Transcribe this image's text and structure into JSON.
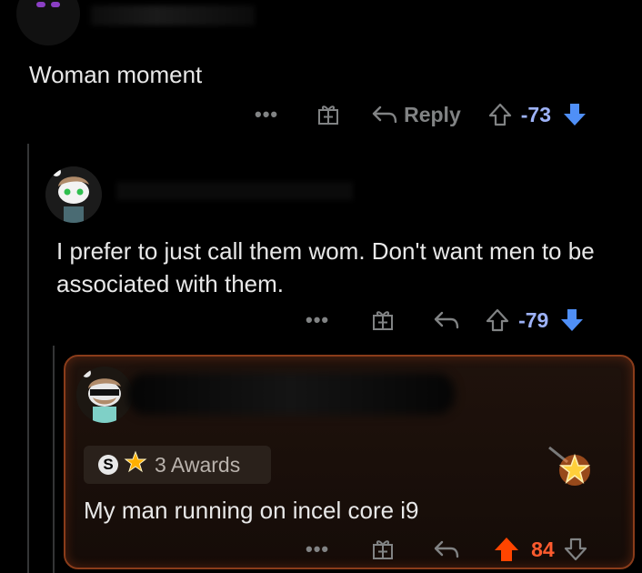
{
  "comments": [
    {
      "text": "Woman moment",
      "reply_label": "Reply",
      "votes": "-73"
    },
    {
      "text": "I prefer to just call them wom. Don't want men to be associated with them.",
      "votes": "-79"
    },
    {
      "awards_label": "3 Awards",
      "text": "My man running on incel core i9",
      "votes": "84"
    }
  ],
  "colors": {
    "background": "#000000",
    "text": "#e8e8e8",
    "muted": "#818384",
    "downvote": "#4f8ff7",
    "upvote_active": "#ff4500",
    "highlight_border": "#8a3c1a"
  },
  "icons": [
    "more-icon",
    "gift-icon",
    "reply-icon",
    "upvote-icon",
    "downvote-icon",
    "award-icon",
    "star-award-icon"
  ]
}
